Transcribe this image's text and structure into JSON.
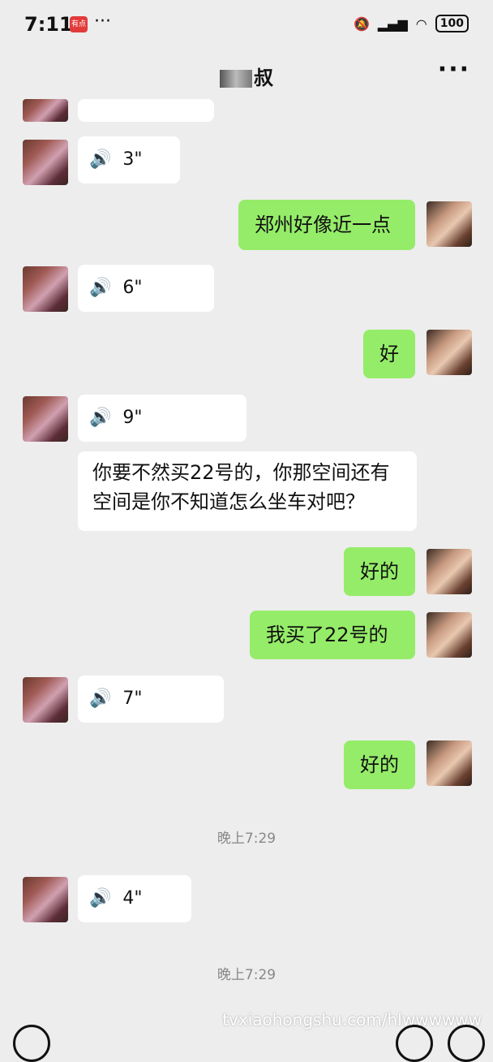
{
  "status_bar": {
    "time": "7:11",
    "app_badge": "有点",
    "more": "···",
    "battery": "100"
  },
  "header": {
    "contact_name": "叔",
    "more_icon": "···"
  },
  "messages": [
    {
      "type": "voice",
      "dir": "in",
      "duration": "3\""
    },
    {
      "type": "text",
      "dir": "out",
      "text": "郑州好像近一点"
    },
    {
      "type": "voice",
      "dir": "in",
      "duration": "6\""
    },
    {
      "type": "text",
      "dir": "out",
      "text": "好"
    },
    {
      "type": "voice",
      "dir": "in",
      "duration": "9\""
    },
    {
      "type": "text",
      "dir": "in",
      "text": "你要不然买22号的，你那空间还有空间是你不知道怎么坐车对吧？"
    },
    {
      "type": "text",
      "dir": "out",
      "text": "好的"
    },
    {
      "type": "text",
      "dir": "out",
      "text": "我买了22号的"
    },
    {
      "type": "voice",
      "dir": "in",
      "duration": "7\""
    },
    {
      "type": "text",
      "dir": "out",
      "text": "好的"
    },
    {
      "type": "voice",
      "dir": "in",
      "duration": "4\""
    }
  ],
  "timestamps": [
    "晚上7:29",
    "晚上7:29"
  ],
  "watermark": "tvxiaohongshu.com/hlwwwwww"
}
